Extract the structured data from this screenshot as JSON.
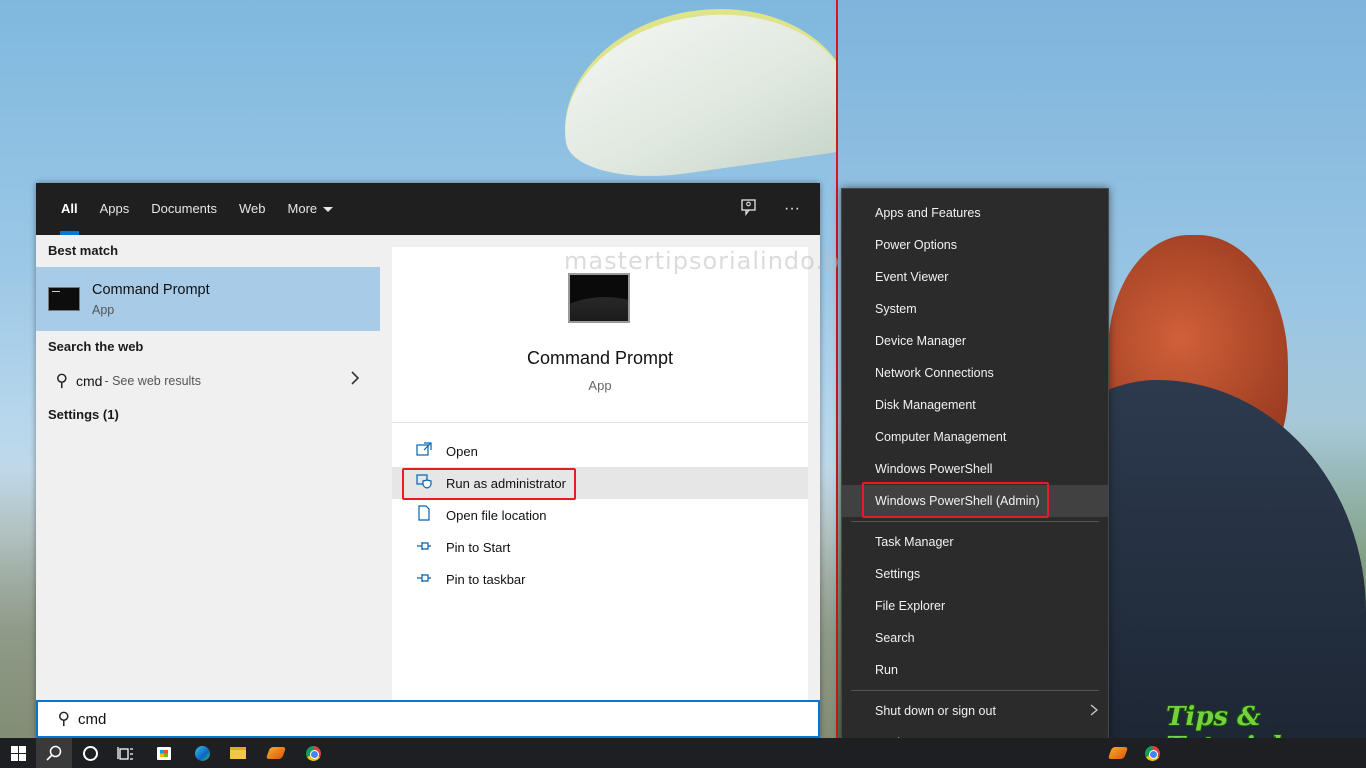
{
  "search_panel": {
    "tabs": [
      {
        "label": "All"
      },
      {
        "label": "Apps"
      },
      {
        "label": "Documents"
      },
      {
        "label": "Web"
      },
      {
        "label": "More"
      }
    ],
    "header_icons": [
      "feedback-icon",
      "more-options-icon"
    ],
    "more_options_glyph": "···",
    "best_match": {
      "section_title": "Best match",
      "name": "Command Prompt",
      "type": "App"
    },
    "search_web": {
      "section_title": "Search the web",
      "query": "cmd",
      "suffix": " - See web results"
    },
    "settings_section": "Settings (1)",
    "preview": {
      "watermark": "mastertipsorialindo.blogspot.com",
      "name": "Command Prompt",
      "type": "App"
    },
    "actions": [
      {
        "label": "Open",
        "icon": "open-icon"
      },
      {
        "label": "Run as administrator",
        "icon": "shield-icon"
      },
      {
        "label": "Open file location",
        "icon": "file-icon"
      },
      {
        "label": "Pin to Start",
        "icon": "pin-icon"
      },
      {
        "label": "Pin to taskbar",
        "icon": "pin-icon"
      }
    ],
    "search_box": {
      "value": "cmd"
    }
  },
  "winx_menu": {
    "group1": [
      {
        "label": "Apps and Features"
      },
      {
        "label": "Power Options"
      },
      {
        "label": "Event Viewer"
      },
      {
        "label": "System"
      },
      {
        "label": "Device Manager"
      },
      {
        "label": "Network Connections"
      },
      {
        "label": "Disk Management"
      },
      {
        "label": "Computer Management"
      },
      {
        "label": "Windows PowerShell"
      },
      {
        "label": "Windows PowerShell (Admin)"
      }
    ],
    "group2": [
      {
        "label": "Task Manager"
      },
      {
        "label": "Settings"
      },
      {
        "label": "File Explorer"
      },
      {
        "label": "Search"
      },
      {
        "label": "Run"
      }
    ],
    "group3": [
      {
        "label": "Shut down or sign out"
      },
      {
        "label": "Desktop"
      }
    ]
  },
  "wallpaper": {
    "brand_text": "Tips & Tutorial"
  },
  "colors": {
    "accent": "#0078d7",
    "highlight_box": "#e51c23",
    "best_match_bg": "#a8cbe8",
    "menu_bg": "#2b2b2b"
  }
}
